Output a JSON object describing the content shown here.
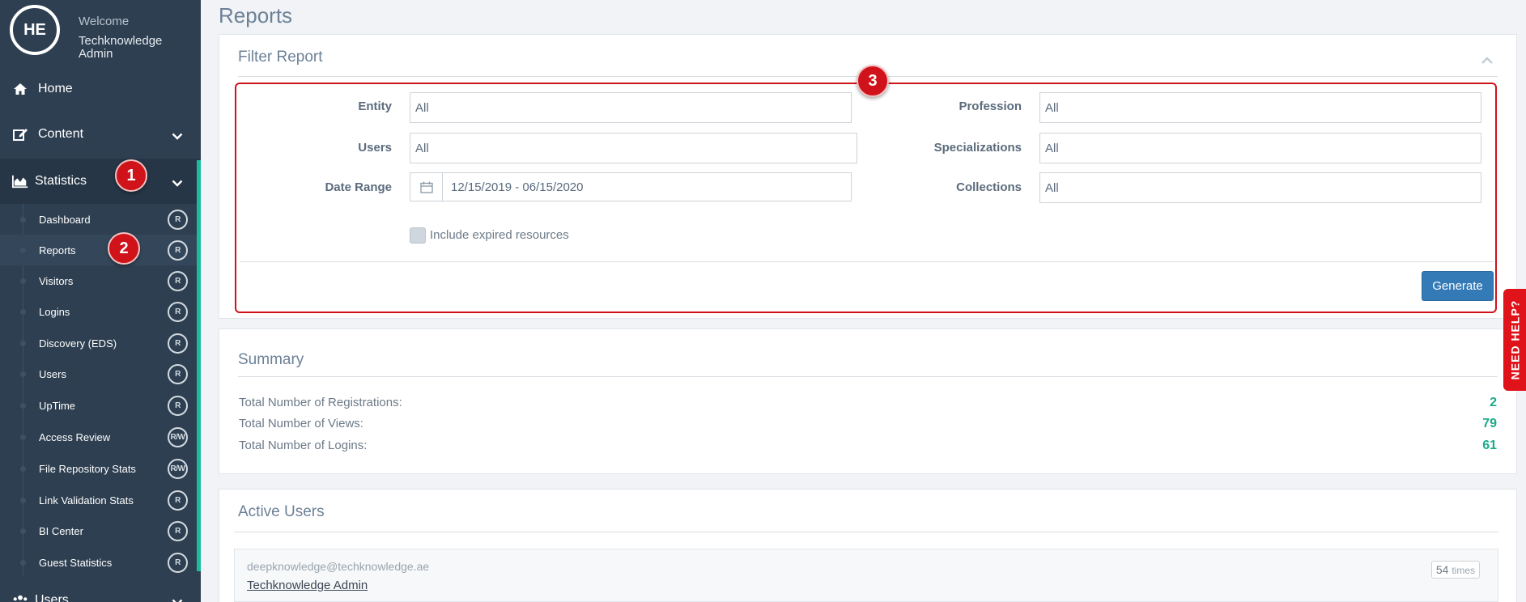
{
  "colors": {
    "sidebar_bg": "#2e3f51",
    "accent": "#1abc9c",
    "primary_button": "#337ab7",
    "badge_red": "#d0121b",
    "value_green": "#1aab8a"
  },
  "sidebar": {
    "avatar_initials": "HE",
    "welcome": "Welcome",
    "user_name": "Techknowledge Admin",
    "nav": [
      {
        "label": "Home",
        "icon": "home-icon"
      },
      {
        "label": "Content",
        "icon": "edit-icon"
      },
      {
        "label": "Statistics",
        "icon": "area-chart-icon"
      },
      {
        "label": "Users",
        "icon": "users-icon"
      }
    ],
    "sub_items": [
      {
        "label": "Dashboard",
        "perm": "R"
      },
      {
        "label": "Reports",
        "perm": "R"
      },
      {
        "label": "Visitors",
        "perm": "R"
      },
      {
        "label": "Logins",
        "perm": "R"
      },
      {
        "label": "Discovery (EDS)",
        "perm": "R"
      },
      {
        "label": "Users",
        "perm": "R"
      },
      {
        "label": "UpTime",
        "perm": "R"
      },
      {
        "label": "Access Review",
        "perm": "R/W"
      },
      {
        "label": "File Repository Stats",
        "perm": "R/W"
      },
      {
        "label": "Link Validation Stats",
        "perm": "R"
      },
      {
        "label": "BI Center",
        "perm": "R"
      },
      {
        "label": "Guest Statistics",
        "perm": "R"
      }
    ]
  },
  "badges": [
    "1",
    "2",
    "3"
  ],
  "page_title": "Reports",
  "filter": {
    "title": "Filter Report",
    "entity_label": "Entity",
    "entity_value": "All",
    "users_label": "Users",
    "users_value": "All",
    "date_label": "Date Range",
    "date_value": "12/15/2019 - 06/15/2020",
    "profession_label": "Profession",
    "profession_value": "All",
    "specializations_label": "Specializations",
    "specializations_value": "All",
    "collections_label": "Collections",
    "collections_value": "All",
    "include_expired_label": "Include expired resources",
    "include_expired_checked": false,
    "generate_label": "Generate"
  },
  "summary": {
    "title": "Summary",
    "rows": [
      {
        "label": "Total Number of Registrations:",
        "value": "2"
      },
      {
        "label": "Total Number of Views:",
        "value": "79"
      },
      {
        "label": "Total Number of Logins:",
        "value": "61"
      }
    ]
  },
  "active_users": {
    "title": "Active Users",
    "rows": [
      {
        "email": "deepknowledge@techknowledge.ae",
        "name": "Techknowledge Admin",
        "count": "54",
        "count_unit": "times"
      }
    ]
  },
  "need_help": "NEED HELP?"
}
